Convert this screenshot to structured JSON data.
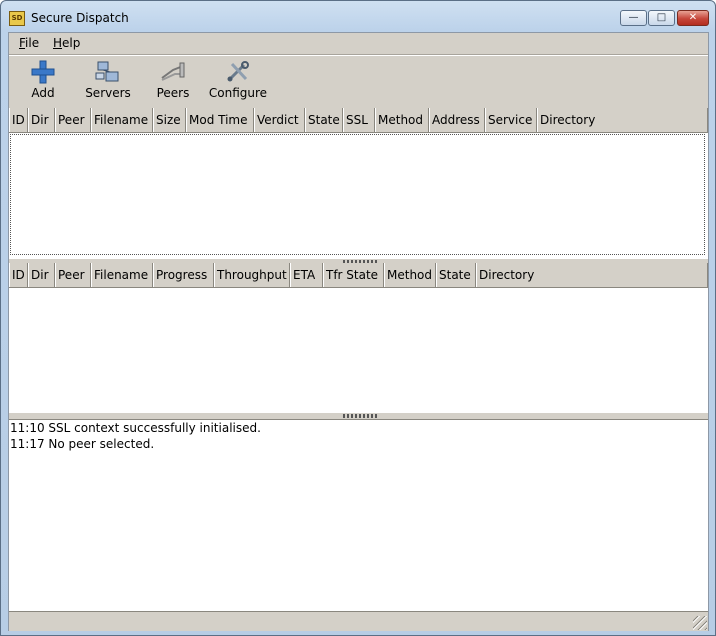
{
  "window": {
    "title": "Secure Dispatch",
    "icon_text": "SD"
  },
  "menu": [
    {
      "label": "File",
      "accel": "F",
      "rest": "ile"
    },
    {
      "label": "Help",
      "accel": "H",
      "rest": "elp"
    }
  ],
  "toolbar": [
    {
      "label": "Add",
      "icon": "plus-icon"
    },
    {
      "label": "Servers",
      "icon": "servers-icon"
    },
    {
      "label": "Peers",
      "icon": "peers-icon"
    },
    {
      "label": "Configure",
      "icon": "wrench-icon"
    }
  ],
  "queue_table": {
    "columns": [
      "ID",
      "Dir",
      "Peer",
      "Filename",
      "Size",
      "Mod Time",
      "Verdict",
      "State",
      "SSL",
      "Method",
      "Address",
      "Service",
      "Directory"
    ]
  },
  "transfer_table": {
    "columns": [
      "ID",
      "Dir",
      "Peer",
      "Filename",
      "Progress",
      "Throughput",
      "ETA",
      "Tfr State",
      "Method",
      "State",
      "Directory"
    ]
  },
  "log": [
    "11:10 SSL context successfully initialised.",
    "11:17 No peer selected."
  ],
  "colors": {
    "titlebar": "#bcd2ea",
    "close": "#c6463a",
    "chrome": "#d4d0c8"
  }
}
